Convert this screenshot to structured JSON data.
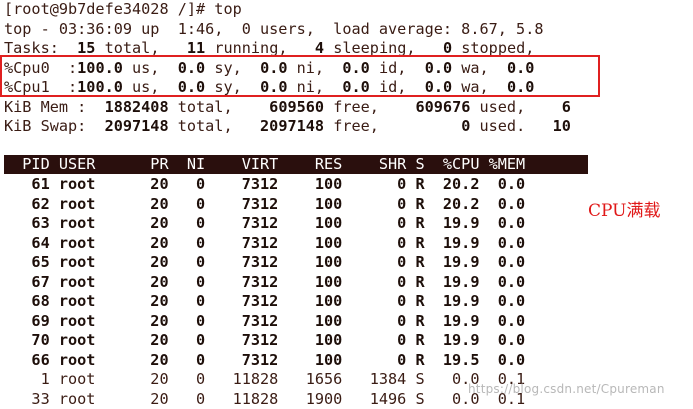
{
  "terminal": {
    "prompt_line": "[root@9b7defe34028 /]# top",
    "summary_line": "top - 03:36:09 up  1:46,  0 users,  load average: 8.67, 5.8",
    "tasks_line": [
      {
        "t": "Tasks: ",
        "b": false
      },
      {
        "t": " 15",
        "b": true
      },
      {
        "t": " total,  ",
        "b": false
      },
      {
        "t": " 11",
        "b": true
      },
      {
        "t": " running,   ",
        "b": false
      },
      {
        "t": "4",
        "b": true
      },
      {
        "t": " sleeping,   ",
        "b": false
      },
      {
        "t": "0",
        "b": true
      },
      {
        "t": " stopped,",
        "b": false
      }
    ],
    "cpu0_line": [
      {
        "t": "%Cpu0  :",
        "b": false
      },
      {
        "t": "100.0",
        "b": true
      },
      {
        "t": " us,  ",
        "b": false
      },
      {
        "t": "0.0",
        "b": true
      },
      {
        "t": " sy,  ",
        "b": false
      },
      {
        "t": "0.0",
        "b": true
      },
      {
        "t": " ni,  ",
        "b": false
      },
      {
        "t": "0.0",
        "b": true
      },
      {
        "t": " id,  ",
        "b": false
      },
      {
        "t": "0.0",
        "b": true
      },
      {
        "t": " wa,  ",
        "b": false
      },
      {
        "t": "0.0",
        "b": true
      }
    ],
    "cpu1_line": [
      {
        "t": "%Cpu1  :",
        "b": false
      },
      {
        "t": "100.0",
        "b": true
      },
      {
        "t": " us,  ",
        "b": false
      },
      {
        "t": "0.0",
        "b": true
      },
      {
        "t": " sy,  ",
        "b": false
      },
      {
        "t": "0.0",
        "b": true
      },
      {
        "t": " ni,  ",
        "b": false
      },
      {
        "t": "0.0",
        "b": true
      },
      {
        "t": " id,  ",
        "b": false
      },
      {
        "t": "0.0",
        "b": true
      },
      {
        "t": " wa,  ",
        "b": false
      },
      {
        "t": "0.0",
        "b": true
      }
    ],
    "mem_line": [
      {
        "t": "KiB Mem : ",
        "b": false
      },
      {
        "t": " 1882408",
        "b": true
      },
      {
        "t": " total,  ",
        "b": false
      },
      {
        "t": "  609560",
        "b": true
      },
      {
        "t": " free,  ",
        "b": false
      },
      {
        "t": "  609676",
        "b": true
      },
      {
        "t": " used,  ",
        "b": false
      },
      {
        "t": "  6",
        "b": true
      }
    ],
    "swap_line": [
      {
        "t": "KiB Swap: ",
        "b": false
      },
      {
        "t": " 2097148",
        "b": true
      },
      {
        "t": " total,  ",
        "b": false
      },
      {
        "t": " 2097148",
        "b": true
      },
      {
        "t": " free,  ",
        "b": false
      },
      {
        "t": "       0",
        "b": true
      },
      {
        "t": " used.  ",
        "b": false
      },
      {
        "t": " 10",
        "b": true
      }
    ]
  },
  "process_table": {
    "header": "  PID USER      PR  NI    VIRT    RES    SHR S  %CPU %MEM",
    "rows": [
      {
        "pid": "61",
        "user": "root",
        "pr": "20",
        "ni": "0",
        "virt": "7312",
        "res": "100",
        "shr": "0",
        "s": "R",
        "cpu": "20.2",
        "mem": "0.0",
        "running": true
      },
      {
        "pid": "62",
        "user": "root",
        "pr": "20",
        "ni": "0",
        "virt": "7312",
        "res": "100",
        "shr": "0",
        "s": "R",
        "cpu": "20.2",
        "mem": "0.0",
        "running": true
      },
      {
        "pid": "63",
        "user": "root",
        "pr": "20",
        "ni": "0",
        "virt": "7312",
        "res": "100",
        "shr": "0",
        "s": "R",
        "cpu": "19.9",
        "mem": "0.0",
        "running": true
      },
      {
        "pid": "64",
        "user": "root",
        "pr": "20",
        "ni": "0",
        "virt": "7312",
        "res": "100",
        "shr": "0",
        "s": "R",
        "cpu": "19.9",
        "mem": "0.0",
        "running": true
      },
      {
        "pid": "65",
        "user": "root",
        "pr": "20",
        "ni": "0",
        "virt": "7312",
        "res": "100",
        "shr": "0",
        "s": "R",
        "cpu": "19.9",
        "mem": "0.0",
        "running": true
      },
      {
        "pid": "67",
        "user": "root",
        "pr": "20",
        "ni": "0",
        "virt": "7312",
        "res": "100",
        "shr": "0",
        "s": "R",
        "cpu": "19.9",
        "mem": "0.0",
        "running": true
      },
      {
        "pid": "68",
        "user": "root",
        "pr": "20",
        "ni": "0",
        "virt": "7312",
        "res": "100",
        "shr": "0",
        "s": "R",
        "cpu": "19.9",
        "mem": "0.0",
        "running": true
      },
      {
        "pid": "69",
        "user": "root",
        "pr": "20",
        "ni": "0",
        "virt": "7312",
        "res": "100",
        "shr": "0",
        "s": "R",
        "cpu": "19.9",
        "mem": "0.0",
        "running": true
      },
      {
        "pid": "70",
        "user": "root",
        "pr": "20",
        "ni": "0",
        "virt": "7312",
        "res": "100",
        "shr": "0",
        "s": "R",
        "cpu": "19.9",
        "mem": "0.0",
        "running": true
      },
      {
        "pid": "66",
        "user": "root",
        "pr": "20",
        "ni": "0",
        "virt": "7312",
        "res": "100",
        "shr": "0",
        "s": "R",
        "cpu": "19.5",
        "mem": "0.0",
        "running": true
      },
      {
        "pid": "1",
        "user": "root",
        "pr": "20",
        "ni": "0",
        "virt": "11828",
        "res": "1656",
        "shr": "1384",
        "s": "S",
        "cpu": "0.0",
        "mem": "0.1",
        "running": false
      },
      {
        "pid": "33",
        "user": "root",
        "pr": "20",
        "ni": "0",
        "virt": "11828",
        "res": "1900",
        "shr": "1496",
        "s": "S",
        "cpu": "0.0",
        "mem": "0.1",
        "running": false
      }
    ]
  },
  "annotation": {
    "text": "CPU满载",
    "color": "#e01818"
  },
  "watermark": {
    "text": "https://blog.csdn.net/Cpureman"
  },
  "colors": {
    "header_bg": "#2a0f0d",
    "highlight_box": "#e02020",
    "text": "#3a1c14"
  }
}
